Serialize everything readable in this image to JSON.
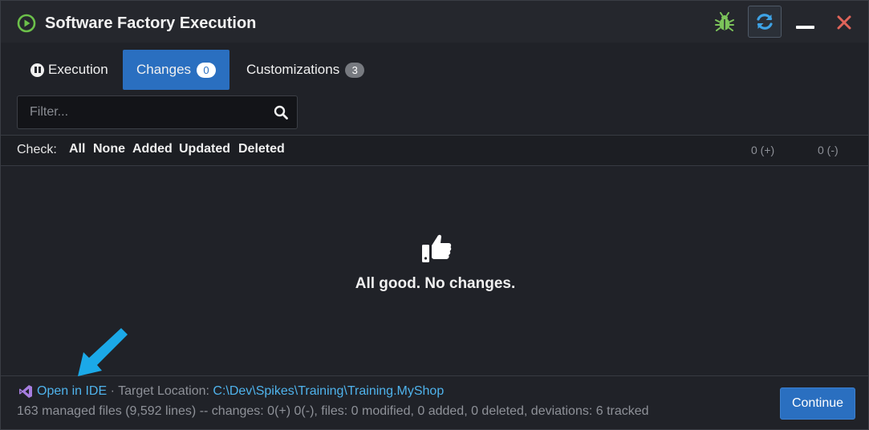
{
  "window": {
    "title": "Software Factory Execution",
    "icons": {
      "app": "play-circle-icon",
      "bug": "bug-icon",
      "refresh": "refresh-icon",
      "minimize": "minimize-icon",
      "close": "close-icon"
    }
  },
  "tabs": [
    {
      "label": "Execution",
      "icon": "pause-icon",
      "active": false
    },
    {
      "label": "Changes",
      "badge": "0",
      "active": true
    },
    {
      "label": "Customizations",
      "badge": "3",
      "active": false
    }
  ],
  "filter": {
    "placeholder": "Filter...",
    "value": "",
    "icon": "search-icon"
  },
  "check": {
    "label": "Check:",
    "options": [
      "All",
      "None",
      "Added",
      "Updated",
      "Deleted"
    ],
    "added_count": "0 (+)",
    "removed_count": "0 (-)"
  },
  "empty_state": {
    "icon": "thumbs-up-icon",
    "message": "All good. No changes."
  },
  "footer": {
    "ide_icon": "visual-studio-icon",
    "open_in_ide": "Open in IDE",
    "separator": " · Target Location: ",
    "target_location": "C:\\Dev\\Spikes\\Training\\Training.MyShop",
    "summary": "163 managed files (9,592 lines) -- changes: 0(+) 0(-), files: 0 modified, 0 added, 0 deleted, deviations: 6 tracked",
    "continue_label": "Continue"
  },
  "colors": {
    "accent": "#2a6fc0",
    "link": "#4fb3ec",
    "bug": "#7cc45a",
    "close": "#e0645a",
    "arrow": "#1ba9e8"
  }
}
